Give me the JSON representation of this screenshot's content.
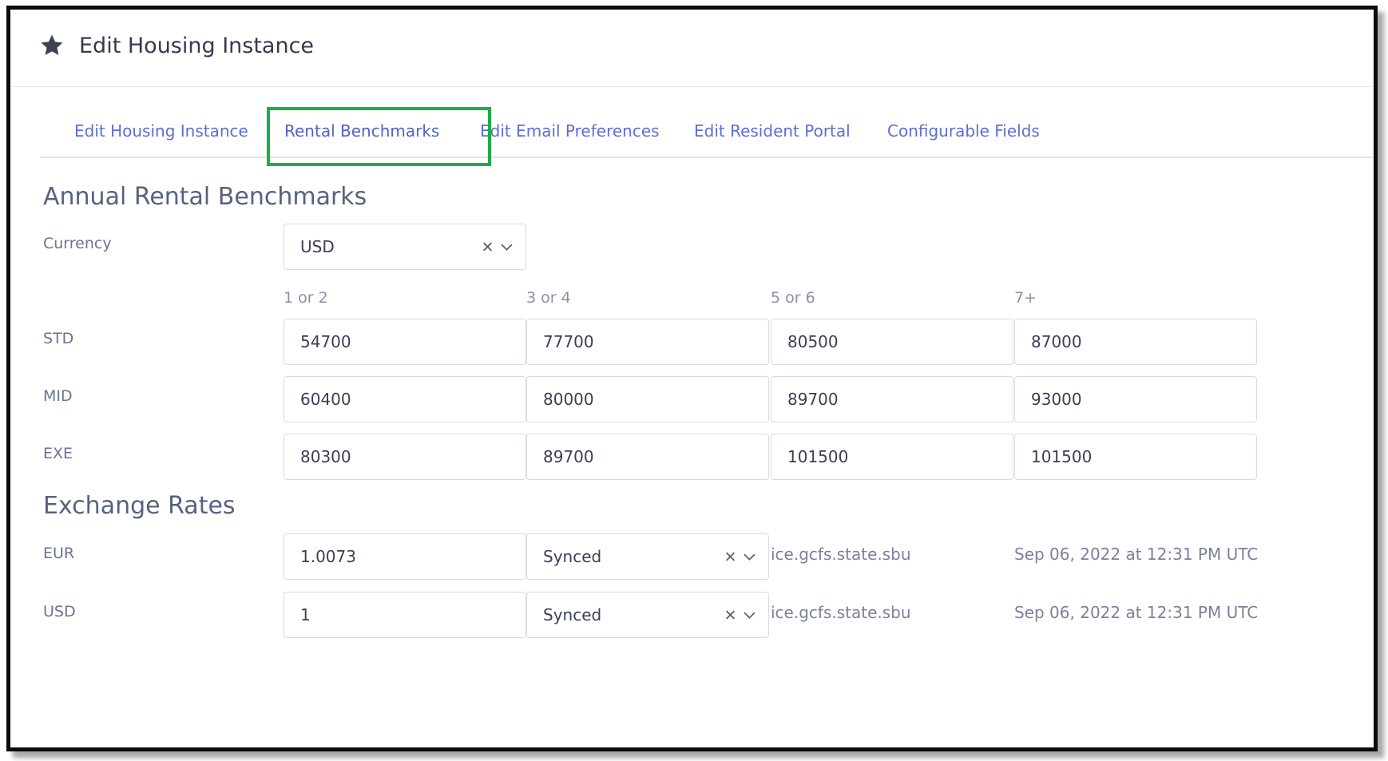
{
  "page": {
    "title": "Edit Housing Instance"
  },
  "tabs": [
    {
      "label": "Edit Housing Instance"
    },
    {
      "label": "Rental Benchmarks",
      "active": true
    },
    {
      "label": "Edit Email Preferences"
    },
    {
      "label": "Edit Resident Portal"
    },
    {
      "label": "Configurable Fields"
    }
  ],
  "benchmarks": {
    "section_title": "Annual Rental Benchmarks",
    "currency_label": "Currency",
    "currency_value": "USD",
    "columns": [
      "1 or 2",
      "3 or 4",
      "5 or 6",
      "7+"
    ],
    "rows": [
      {
        "label": "STD",
        "values": [
          "54700",
          "77700",
          "80500",
          "87000"
        ]
      },
      {
        "label": "MID",
        "values": [
          "60400",
          "80000",
          "89700",
          "93000"
        ]
      },
      {
        "label": "EXE",
        "values": [
          "80300",
          "89700",
          "101500",
          "101500"
        ]
      }
    ]
  },
  "exchange": {
    "section_title": "Exchange Rates",
    "rows": [
      {
        "currency": "EUR",
        "rate": "1.0073",
        "status": "Synced",
        "source": "ice.gcfs.state.sbu",
        "updated": "Sep 06, 2022 at 12:31 PM UTC"
      },
      {
        "currency": "USD",
        "rate": "1",
        "status": "Synced",
        "source": "ice.gcfs.state.sbu",
        "updated": "Sep 06, 2022 at 12:31 PM UTC"
      }
    ]
  },
  "colors": {
    "accent": "#5b6fd6",
    "highlight": "#1eac48"
  }
}
